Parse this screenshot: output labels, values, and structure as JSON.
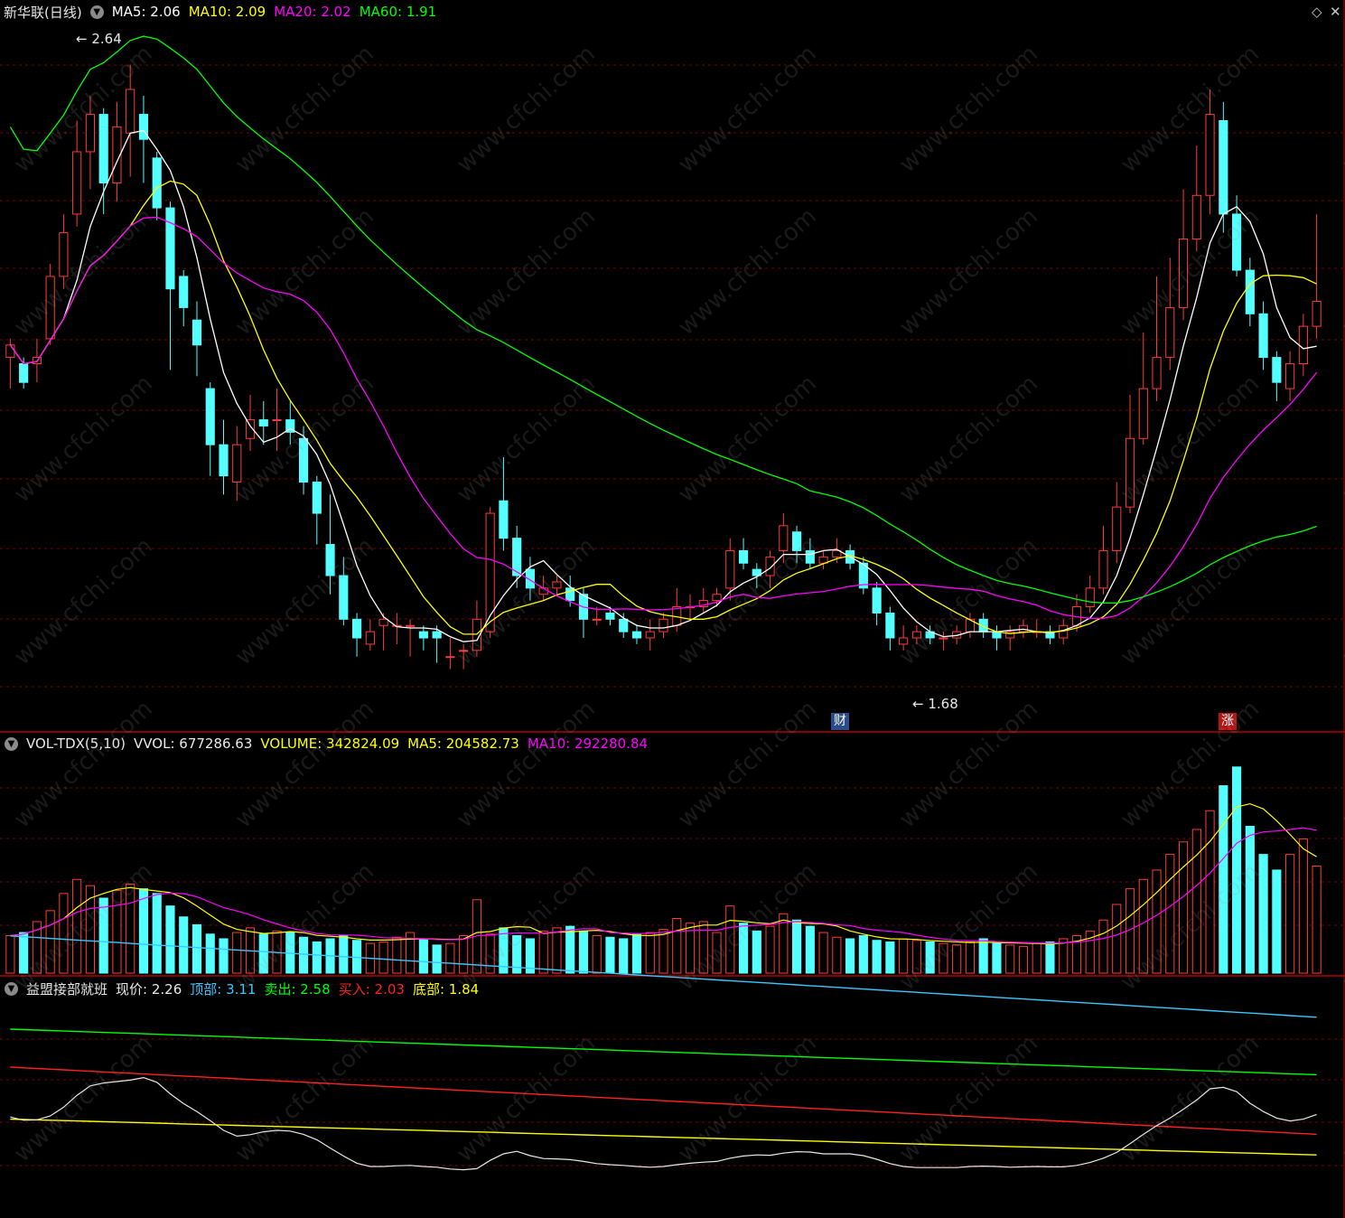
{
  "main": {
    "stock_name": "新华联(日线)",
    "ma5": "MA5: 2.06",
    "ma10": "MA10: 2.09",
    "ma20": "MA20: 2.02",
    "ma60": "MA60: 1.91",
    "high_marker": "2.64",
    "low_marker": "1.68",
    "tag_cai": "财",
    "tag_zhang": "涨"
  },
  "vol": {
    "name": "VOL-TDX(5,10)",
    "vvol": "VVOL: 677286.63",
    "volume": "VOLUME: 342824.09",
    "ma5": "MA5: 204582.73",
    "ma10": "MA10: 292280.84"
  },
  "ind": {
    "name": "益盟接部就班",
    "price": "现价: 2.26",
    "top": "顶部: 3.11",
    "sell": "卖出: 2.58",
    "buy": "买入: 2.03",
    "bottom": "底部: 1.84"
  },
  "colors": {
    "up": "#ff3b3b",
    "down": "#54ffff",
    "ma5": "#ffffff",
    "ma10": "#ffff00",
    "ma20": "#ff00ff",
    "ma60": "#00ff00",
    "grid": "#7a0000",
    "separator": "#b40000"
  },
  "watermark": "www.cfchi.com",
  "chart_data": [
    {
      "type": "candlestick",
      "y_range": [
        1.62,
        2.7
      ],
      "series_ma": [
        "MA5",
        "MA10",
        "MA20",
        "MA60"
      ],
      "candles": [
        [
          2.17,
          2.19,
          2.2,
          2.12
        ],
        [
          2.16,
          2.13,
          2.17,
          2.12
        ],
        [
          2.16,
          2.17,
          2.2,
          2.13
        ],
        [
          2.2,
          2.3,
          2.32,
          2.19
        ],
        [
          2.3,
          2.37,
          2.4,
          2.28
        ],
        [
          2.4,
          2.5,
          2.55,
          2.38
        ],
        [
          2.5,
          2.56,
          2.59,
          2.44
        ],
        [
          2.56,
          2.45,
          2.57,
          2.4
        ],
        [
          2.45,
          2.54,
          2.58,
          2.42
        ],
        [
          2.53,
          2.6,
          2.64,
          2.46
        ],
        [
          2.56,
          2.52,
          2.59,
          2.45
        ],
        [
          2.49,
          2.41,
          2.5,
          2.39
        ],
        [
          2.41,
          2.28,
          2.42,
          2.15
        ],
        [
          2.3,
          2.25,
          2.31,
          2.22
        ],
        [
          2.23,
          2.19,
          2.26,
          2.14
        ],
        [
          2.12,
          2.03,
          2.13,
          1.98
        ],
        [
          2.03,
          1.98,
          2.07,
          1.95
        ],
        [
          1.97,
          2.03,
          2.06,
          1.94
        ],
        [
          2.04,
          2.07,
          2.11,
          2.02
        ],
        [
          2.07,
          2.06,
          2.1,
          2.03
        ],
        [
          2.07,
          2.07,
          2.12,
          2.02
        ],
        [
          2.07,
          2.05,
          2.1,
          2.03
        ],
        [
          2.04,
          1.97,
          2.06,
          1.95
        ],
        [
          1.97,
          1.92,
          1.98,
          1.87
        ],
        [
          1.87,
          1.82,
          1.95,
          1.79
        ],
        [
          1.82,
          1.75,
          1.85,
          1.74
        ],
        [
          1.75,
          1.72,
          1.76,
          1.69
        ],
        [
          1.71,
          1.73,
          1.75,
          1.7
        ],
        [
          1.74,
          1.75,
          1.76,
          1.7
        ],
        [
          1.74,
          1.74,
          1.76,
          1.71
        ],
        [
          1.74,
          1.74,
          1.75,
          1.69
        ],
        [
          1.73,
          1.72,
          1.74,
          1.7
        ],
        [
          1.73,
          1.72,
          1.74,
          1.68
        ],
        [
          1.69,
          1.69,
          1.72,
          1.67
        ],
        [
          1.7,
          1.7,
          1.71,
          1.67
        ],
        [
          1.7,
          1.75,
          1.78,
          1.69
        ],
        [
          1.73,
          1.92,
          1.93,
          1.72
        ],
        [
          1.94,
          1.88,
          2.01,
          1.86
        ],
        [
          1.88,
          1.82,
          1.9,
          1.8
        ],
        [
          1.83,
          1.8,
          1.85,
          1.78
        ],
        [
          1.79,
          1.8,
          1.82,
          1.78
        ],
        [
          1.8,
          1.81,
          1.82,
          1.79
        ],
        [
          1.8,
          1.78,
          1.82,
          1.77
        ],
        [
          1.79,
          1.75,
          1.8,
          1.72
        ],
        [
          1.75,
          1.75,
          1.77,
          1.74
        ],
        [
          1.76,
          1.75,
          1.77,
          1.74
        ],
        [
          1.75,
          1.73,
          1.76,
          1.72
        ],
        [
          1.73,
          1.72,
          1.74,
          1.71
        ],
        [
          1.72,
          1.73,
          1.75,
          1.7
        ],
        [
          1.73,
          1.75,
          1.76,
          1.72
        ],
        [
          1.74,
          1.77,
          1.8,
          1.73
        ],
        [
          1.77,
          1.77,
          1.79,
          1.75
        ],
        [
          1.77,
          1.78,
          1.8,
          1.76
        ],
        [
          1.78,
          1.79,
          1.8,
          1.77
        ],
        [
          1.8,
          1.86,
          1.88,
          1.78
        ],
        [
          1.86,
          1.84,
          1.88,
          1.83
        ],
        [
          1.83,
          1.82,
          1.84,
          1.8
        ],
        [
          1.82,
          1.85,
          1.86,
          1.8
        ],
        [
          1.86,
          1.9,
          1.92,
          1.84
        ],
        [
          1.89,
          1.86,
          1.9,
          1.84
        ],
        [
          1.86,
          1.84,
          1.88,
          1.83
        ],
        [
          1.84,
          1.85,
          1.86,
          1.83
        ],
        [
          1.85,
          1.86,
          1.88,
          1.84
        ],
        [
          1.86,
          1.84,
          1.87,
          1.83
        ],
        [
          1.84,
          1.8,
          1.85,
          1.79
        ],
        [
          1.8,
          1.76,
          1.81,
          1.74
        ],
        [
          1.76,
          1.72,
          1.77,
          1.7
        ],
        [
          1.71,
          1.72,
          1.74,
          1.7
        ],
        [
          1.72,
          1.73,
          1.74,
          1.71
        ],
        [
          1.73,
          1.72,
          1.74,
          1.71
        ],
        [
          1.72,
          1.72,
          1.73,
          1.7
        ],
        [
          1.72,
          1.73,
          1.74,
          1.71
        ],
        [
          1.73,
          1.75,
          1.76,
          1.72
        ],
        [
          1.75,
          1.73,
          1.76,
          1.72
        ],
        [
          1.73,
          1.72,
          1.74,
          1.7
        ],
        [
          1.72,
          1.73,
          1.74,
          1.7
        ],
        [
          1.73,
          1.74,
          1.75,
          1.72
        ],
        [
          1.73,
          1.73,
          1.75,
          1.72
        ],
        [
          1.73,
          1.72,
          1.74,
          1.71
        ],
        [
          1.72,
          1.74,
          1.75,
          1.71
        ],
        [
          1.74,
          1.77,
          1.79,
          1.73
        ],
        [
          1.77,
          1.8,
          1.82,
          1.76
        ],
        [
          1.8,
          1.86,
          1.9,
          1.79
        ],
        [
          1.86,
          1.93,
          1.97,
          1.84
        ],
        [
          1.93,
          2.04,
          2.11,
          1.92
        ],
        [
          2.04,
          2.12,
          2.21,
          2.03
        ],
        [
          2.12,
          2.17,
          2.3,
          2.1
        ],
        [
          2.17,
          2.25,
          2.33,
          2.15
        ],
        [
          2.25,
          2.36,
          2.44,
          2.23
        ],
        [
          2.36,
          2.43,
          2.51,
          2.34
        ],
        [
          2.43,
          2.56,
          2.6,
          2.4
        ],
        [
          2.55,
          2.4,
          2.58,
          2.37
        ],
        [
          2.4,
          2.31,
          2.43,
          2.3
        ],
        [
          2.31,
          2.24,
          2.33,
          2.22
        ],
        [
          2.24,
          2.17,
          2.26,
          2.15
        ],
        [
          2.17,
          2.13,
          2.18,
          2.1
        ],
        [
          2.12,
          2.16,
          2.18,
          2.1
        ],
        [
          2.16,
          2.22,
          2.24,
          2.14
        ],
        [
          2.22,
          2.26,
          2.4,
          2.2
        ]
      ]
    },
    {
      "type": "bar",
      "name": "VOL-TDX",
      "y_range": [
        0,
        700000
      ],
      "series": [
        {
          "name": "VOLUME",
          "values": [
            120000,
            130000,
            165000,
            200000,
            255000,
            300000,
            280000,
            240000,
            265000,
            285000,
            270000,
            255000,
            215000,
            180000,
            155000,
            125000,
            110000,
            130000,
            145000,
            125000,
            135000,
            130000,
            115000,
            100000,
            110000,
            120000,
            105000,
            95000,
            100000,
            115000,
            130000,
            110000,
            90000,
            95000,
            120000,
            235000,
            125000,
            145000,
            120000,
            110000,
            135000,
            145000,
            150000,
            135000,
            120000,
            115000,
            110000,
            125000,
            130000,
            140000,
            175000,
            160000,
            165000,
            130000,
            215000,
            160000,
            135000,
            150000,
            190000,
            170000,
            150000,
            130000,
            115000,
            110000,
            120000,
            105000,
            100000,
            110000,
            105000,
            100000,
            95000,
            90000,
            100000,
            110000,
            95000,
            90000,
            85000,
            95000,
            100000,
            110000,
            120000,
            135000,
            170000,
            220000,
            270000,
            300000,
            330000,
            380000,
            420000,
            460000,
            520000,
            600000,
            660000,
            470000,
            380000,
            330000,
            380000,
            430000,
            342824
          ]
        }
      ]
    },
    {
      "type": "line",
      "name": "益盟接部就班",
      "series": [
        {
          "name": "顶部",
          "values": [
            3.11
          ]
        },
        {
          "name": "卖出",
          "values": [
            2.58
          ]
        },
        {
          "name": "买入",
          "values": [
            2.03
          ]
        },
        {
          "name": "底部",
          "values": [
            1.84
          ]
        },
        {
          "name": "现价",
          "values": [
            2.26
          ]
        }
      ]
    }
  ]
}
